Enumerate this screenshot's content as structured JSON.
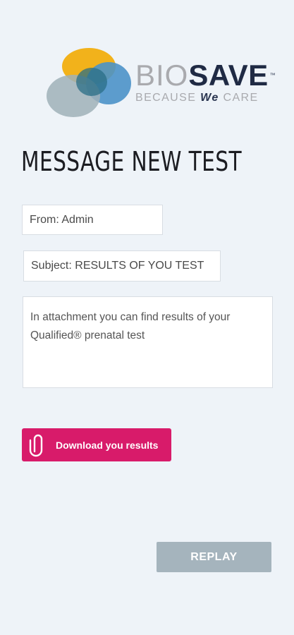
{
  "brand": {
    "name_part1": "BIO",
    "name_part2": "SAVE",
    "tm": "™",
    "tagline_part1": "BECAUSE ",
    "tagline_we": "We",
    "tagline_part2": " CARE"
  },
  "page": {
    "title": "MESSAGE NEW TEST"
  },
  "message": {
    "from": "From: Admin",
    "subject": "Subject: RESULTS OF YOU TEST",
    "body": "In attachment you can find results of your Qualified® prenatal test"
  },
  "actions": {
    "download_label": "Download you results",
    "replay_label": "REPLAY"
  },
  "colors": {
    "background": "#eef3f8",
    "accent_pink": "#d81b6a",
    "replay_gray": "#a5b4bd",
    "brand_dark": "#1f2a44"
  },
  "icons": {
    "download": "paperclip-icon",
    "logo": "biosave-logo-mark"
  }
}
